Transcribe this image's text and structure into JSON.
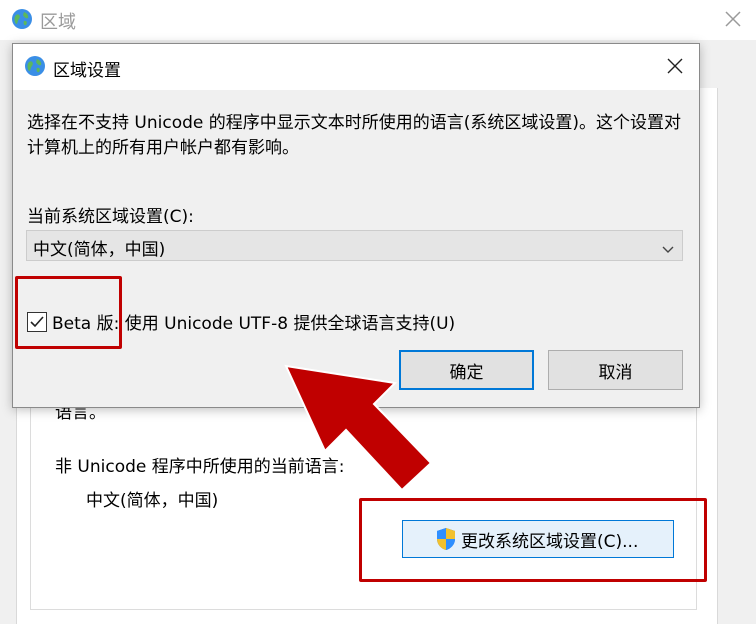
{
  "parent_window": {
    "title": "区域",
    "partial_text": "语言。",
    "nonunicode_label": "非 Unicode 程序中所使用的当前语言:",
    "nonunicode_value": "中文(简体，中国)",
    "change_button_label": "更改系统区域设置(C)..."
  },
  "dialog": {
    "title": "区域设置",
    "description": "选择在不支持 Unicode 的程序中显示文本时所使用的语言(系统区域设置)。这个设置对计算机上的所有用户帐户都有影响。",
    "current_locale_label": "当前系统区域设置(C):",
    "current_locale_value": "中文(简体，中国)",
    "beta_checkbox_label": "Beta 版: 使用 Unicode UTF-8 提供全球语言支持(U)",
    "beta_checked": true,
    "ok_label": "确定",
    "cancel_label": "取消"
  },
  "icons": {
    "globe": "globe-icon",
    "close": "close-icon",
    "dropdown": "chevron-down-icon",
    "shield": "uac-shield-icon",
    "check": "checkmark-icon"
  },
  "colors": {
    "annotation_red": "#c00000",
    "accent_blue": "#0078d7"
  }
}
